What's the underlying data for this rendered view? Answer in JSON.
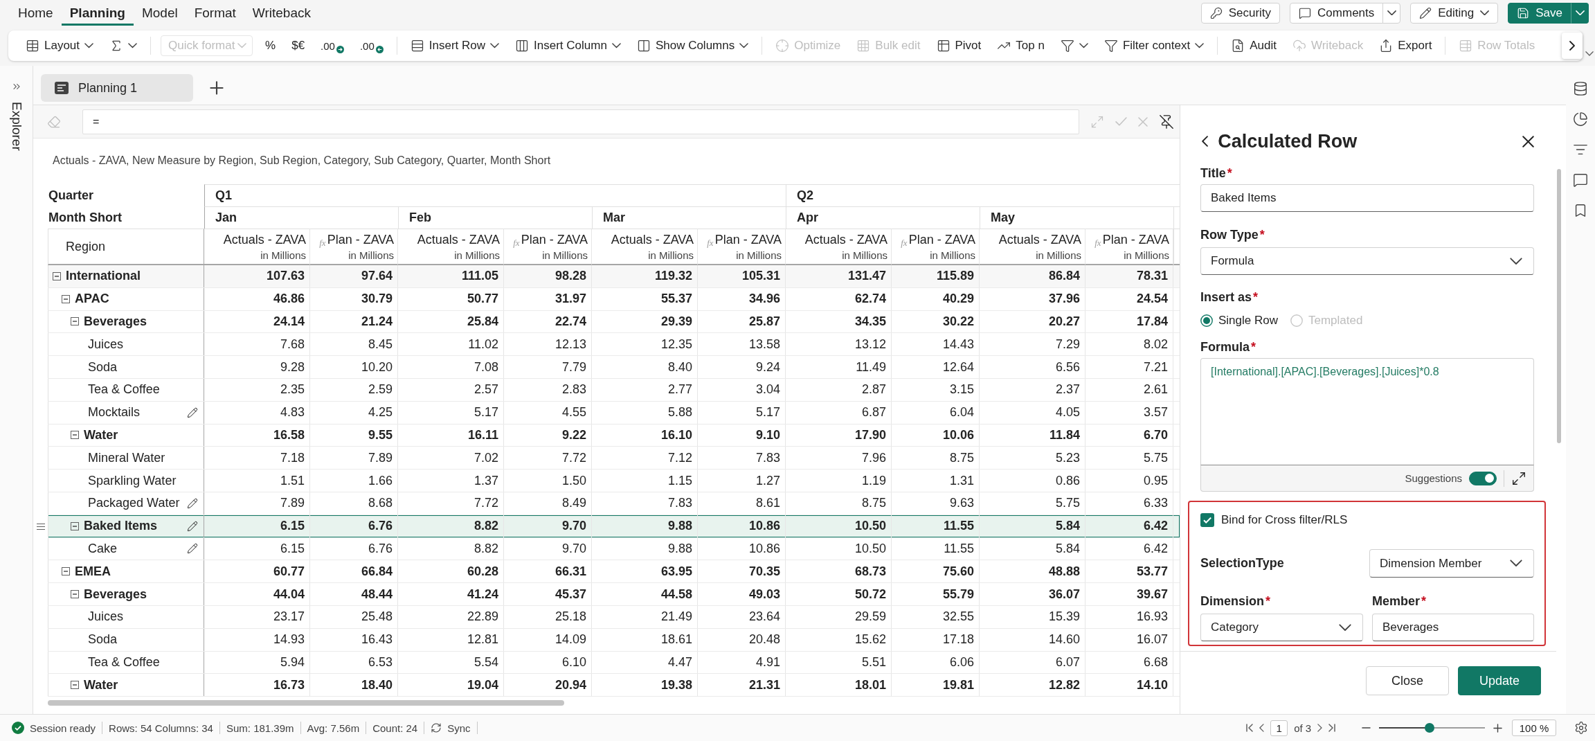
{
  "menu_tabs": [
    {
      "label": "Home",
      "selected": false
    },
    {
      "label": "Planning",
      "selected": true
    },
    {
      "label": "Model",
      "selected": false
    },
    {
      "label": "Format",
      "selected": false
    },
    {
      "label": "Writeback",
      "selected": false
    }
  ],
  "header_actions": [
    {
      "label": "Security",
      "kind": "button"
    },
    {
      "label": "Comments",
      "kind": "split"
    },
    {
      "label": "Editing",
      "kind": "menu"
    },
    {
      "label": "Save",
      "kind": "primary"
    }
  ],
  "toolbar": {
    "groups": [
      [
        {
          "kind": "button",
          "label": "Layout",
          "dropdown": true,
          "disabled": false
        },
        {
          "kind": "icon",
          "dropdown": true,
          "disabled": false
        }
      ],
      [
        {
          "kind": "select",
          "placeholder": "Quick format",
          "dropdown": true,
          "disabled": true
        },
        {
          "kind": "glyph",
          "label": "%",
          "dropdown": false,
          "disabled": false
        },
        {
          "kind": "glyph",
          "label": "$€",
          "dropdown": false,
          "disabled": false
        },
        {
          "kind": "increase",
          "label": ".00",
          "dropdown": false,
          "disabled": false
        },
        {
          "kind": "decrease",
          "label": ".00",
          "dropdown": false,
          "disabled": false
        }
      ],
      [
        {
          "kind": "button",
          "label": "Insert Row",
          "dropdown": true,
          "disabled": false
        },
        {
          "kind": "button",
          "label": "Insert Column",
          "dropdown": true,
          "disabled": false
        },
        {
          "kind": "button",
          "label": "Show Columns",
          "dropdown": true,
          "disabled": false
        }
      ],
      [
        {
          "kind": "button",
          "label": "Optimize",
          "dropdown": false,
          "disabled": true
        },
        {
          "kind": "button",
          "label": "Bulk edit",
          "dropdown": false,
          "disabled": true
        },
        {
          "kind": "button",
          "label": "Pivot",
          "dropdown": false,
          "disabled": false
        },
        {
          "kind": "button",
          "label": "Top n",
          "dropdown": false,
          "disabled": false
        },
        {
          "kind": "icon",
          "dropdown": true,
          "disabled": false
        },
        {
          "kind": "button",
          "label": "Filter context",
          "dropdown": true,
          "disabled": false
        }
      ],
      [
        {
          "kind": "button",
          "label": "Audit",
          "dropdown": false,
          "disabled": false
        },
        {
          "kind": "button",
          "label": "Writeback",
          "dropdown": false,
          "disabled": true
        },
        {
          "kind": "button",
          "label": "Export",
          "dropdown": false,
          "disabled": false
        }
      ],
      [
        {
          "kind": "button",
          "label": "Row Totals",
          "dropdown": false,
          "disabled": true
        }
      ]
    ]
  },
  "explorer": {
    "label": "Explorer"
  },
  "sheet_tabs": [
    {
      "label": "Planning 1",
      "selected": true
    }
  ],
  "formula_bar": {
    "value": "="
  },
  "grid": {
    "title": "Actuals - ZAVA, New Measure by Region, Sub Region, Category, Sub Category, Quarter, Month Short",
    "header_labels": {
      "quarter": "Quarter",
      "month": "Month Short",
      "region": "Region"
    },
    "quarters": [
      {
        "label": "Q1",
        "months": [
          {
            "label": "Jan",
            "measures": [
              {
                "label": "Actuals - ZAVA",
                "unit": "in Millions"
              },
              {
                "label": "Plan - ZAVA",
                "unit": "in Millions",
                "formula_mark": "fx"
              }
            ]
          },
          {
            "label": "Feb",
            "measures": [
              {
                "label": "Actuals - ZAVA",
                "unit": "in Millions"
              },
              {
                "label": "Plan - ZAVA",
                "unit": "in Millions",
                "formula_mark": "fx"
              }
            ]
          },
          {
            "label": "Mar",
            "measures": [
              {
                "label": "Actuals - ZAVA",
                "unit": "in Millions"
              },
              {
                "label": "Plan - ZAVA",
                "unit": "in Millions",
                "formula_mark": "fx"
              }
            ]
          }
        ]
      },
      {
        "label": "Q2",
        "months": [
          {
            "label": "Apr",
            "measures": [
              {
                "label": "Actuals - ZAVA",
                "unit": "in Millions"
              },
              {
                "label": "Plan - ZAVA",
                "unit": "in Millions",
                "formula_mark": "fx"
              }
            ]
          },
          {
            "label": "May",
            "measures": [
              {
                "label": "Actuals - ZAVA",
                "unit": "in Millions"
              },
              {
                "label": "Plan - ZAVA",
                "unit": "in Millions",
                "formula_mark": "fx"
              }
            ]
          }
        ]
      }
    ],
    "rows": [
      {
        "label": "International",
        "kind": "group",
        "expanded": true,
        "selected": false,
        "edited": false,
        "values": [
          "107.63",
          "97.64",
          "111.05",
          "98.28",
          "119.32",
          "105.31",
          "131.47",
          "115.89",
          "86.84",
          "78.31"
        ],
        "children": [
          {
            "label": "APAC",
            "kind": "group",
            "expanded": true,
            "selected": false,
            "edited": false,
            "values": [
              "46.86",
              "30.79",
              "50.77",
              "31.97",
              "55.37",
              "34.96",
              "62.74",
              "40.29",
              "37.96",
              "24.54"
            ],
            "children": [
              {
                "label": "Beverages",
                "kind": "group",
                "expanded": true,
                "selected": false,
                "edited": false,
                "values": [
                  "24.14",
                  "21.24",
                  "25.84",
                  "22.74",
                  "29.39",
                  "25.87",
                  "34.35",
                  "30.22",
                  "20.27",
                  "17.84"
                ],
                "children": [
                  {
                    "label": "Juices",
                    "kind": "leaf",
                    "selected": false,
                    "edited": false,
                    "values": [
                      "7.68",
                      "8.45",
                      "11.02",
                      "12.13",
                      "12.35",
                      "13.58",
                      "13.12",
                      "14.43",
                      "7.29",
                      "8.02"
                    ]
                  },
                  {
                    "label": "Soda",
                    "kind": "leaf",
                    "selected": false,
                    "edited": false,
                    "values": [
                      "9.28",
                      "10.20",
                      "7.08",
                      "7.79",
                      "8.40",
                      "9.24",
                      "11.49",
                      "12.64",
                      "6.56",
                      "7.21"
                    ]
                  },
                  {
                    "label": "Tea & Coffee",
                    "kind": "leaf",
                    "selected": false,
                    "edited": false,
                    "values": [
                      "2.35",
                      "2.59",
                      "2.57",
                      "2.83",
                      "2.77",
                      "3.04",
                      "2.87",
                      "3.15",
                      "2.37",
                      "2.61"
                    ]
                  },
                  {
                    "label": "Mocktails",
                    "kind": "leaf",
                    "selected": false,
                    "edited": true,
                    "values": [
                      "4.83",
                      "4.25",
                      "5.17",
                      "4.55",
                      "5.88",
                      "5.17",
                      "6.87",
                      "6.04",
                      "4.05",
                      "3.57"
                    ]
                  }
                ]
              },
              {
                "label": "Water",
                "kind": "group",
                "expanded": true,
                "selected": false,
                "edited": false,
                "values": [
                  "16.58",
                  "9.55",
                  "16.11",
                  "9.22",
                  "16.10",
                  "9.10",
                  "17.90",
                  "10.06",
                  "11.84",
                  "6.70"
                ],
                "children": [
                  {
                    "label": "Mineral Water",
                    "kind": "leaf",
                    "selected": false,
                    "edited": false,
                    "values": [
                      "7.18",
                      "7.89",
                      "7.02",
                      "7.72",
                      "7.12",
                      "7.83",
                      "7.96",
                      "8.75",
                      "5.23",
                      "5.75"
                    ]
                  },
                  {
                    "label": "Sparkling Water",
                    "kind": "leaf",
                    "selected": false,
                    "edited": false,
                    "values": [
                      "1.51",
                      "1.66",
                      "1.37",
                      "1.50",
                      "1.15",
                      "1.27",
                      "1.19",
                      "1.31",
                      "0.86",
                      "0.95"
                    ]
                  },
                  {
                    "label": "Packaged Water",
                    "kind": "leaf",
                    "selected": false,
                    "edited": true,
                    "values": [
                      "7.89",
                      "8.68",
                      "7.72",
                      "8.49",
                      "7.83",
                      "8.61",
                      "8.75",
                      "9.63",
                      "5.75",
                      "6.33"
                    ]
                  }
                ]
              },
              {
                "label": "Baked Items",
                "kind": "group",
                "expanded": true,
                "selected": true,
                "edited": true,
                "values": [
                  "6.15",
                  "6.76",
                  "8.82",
                  "9.70",
                  "9.88",
                  "10.86",
                  "10.50",
                  "11.55",
                  "5.84",
                  "6.42"
                ],
                "children": [
                  {
                    "label": "Cake",
                    "kind": "leaf",
                    "selected": false,
                    "edited": true,
                    "values": [
                      "6.15",
                      "6.76",
                      "8.82",
                      "9.70",
                      "9.88",
                      "10.86",
                      "10.50",
                      "11.55",
                      "5.84",
                      "6.42"
                    ]
                  }
                ]
              }
            ]
          },
          {
            "label": "EMEA",
            "kind": "group",
            "expanded": true,
            "selected": false,
            "edited": false,
            "values": [
              "60.77",
              "66.84",
              "60.28",
              "66.31",
              "63.95",
              "70.35",
              "68.73",
              "75.60",
              "48.88",
              "53.77"
            ],
            "children": [
              {
                "label": "Beverages",
                "kind": "group",
                "expanded": true,
                "selected": false,
                "edited": false,
                "values": [
                  "44.04",
                  "48.44",
                  "41.24",
                  "45.37",
                  "44.58",
                  "49.03",
                  "50.72",
                  "55.79",
                  "36.07",
                  "39.67"
                ],
                "children": [
                  {
                    "label": "Juices",
                    "kind": "leaf",
                    "selected": false,
                    "edited": false,
                    "values": [
                      "23.17",
                      "25.48",
                      "22.89",
                      "25.18",
                      "21.49",
                      "23.64",
                      "29.59",
                      "32.55",
                      "15.39",
                      "16.93"
                    ]
                  },
                  {
                    "label": "Soda",
                    "kind": "leaf",
                    "selected": false,
                    "edited": false,
                    "values": [
                      "14.93",
                      "16.43",
                      "12.81",
                      "14.09",
                      "18.61",
                      "20.48",
                      "15.62",
                      "17.18",
                      "14.60",
                      "16.07"
                    ]
                  },
                  {
                    "label": "Tea & Coffee",
                    "kind": "leaf",
                    "selected": false,
                    "edited": false,
                    "values": [
                      "5.94",
                      "6.53",
                      "5.54",
                      "6.10",
                      "4.47",
                      "4.91",
                      "5.51",
                      "6.06",
                      "6.07",
                      "6.68"
                    ]
                  }
                ]
              },
              {
                "label": "Water",
                "kind": "group",
                "expanded": true,
                "selected": false,
                "edited": false,
                "values": [
                  "16.73",
                  "18.40",
                  "19.04",
                  "20.94",
                  "19.38",
                  "21.31",
                  "18.01",
                  "19.81",
                  "12.82",
                  "14.10"
                ]
              }
            ]
          }
        ]
      }
    ]
  },
  "calc_panel": {
    "title": "Calculated Row",
    "title_field": {
      "label": "Title",
      "required": "*",
      "value": "Baked Items"
    },
    "row_type": {
      "label": "Row Type",
      "required": "*",
      "value": "Formula"
    },
    "insert_as": {
      "label": "Insert as",
      "required": "*",
      "options": [
        {
          "label": "Single Row",
          "selected": true,
          "disabled": false
        },
        {
          "label": "Templated",
          "selected": false,
          "disabled": true
        }
      ]
    },
    "formula": {
      "label": "Formula",
      "required": "*",
      "value": "[International].[APAC].[Beverages].[Juices]*0.8",
      "suggestions": {
        "label": "Suggestions",
        "on": true
      }
    },
    "cross_filter": {
      "highlighted": true,
      "bind": {
        "label": "Bind for Cross filter/RLS",
        "checked": true
      },
      "selection_type": {
        "label": "SelectionType",
        "value": "Dimension Member"
      },
      "dimension": {
        "label": "Dimension",
        "required": "*",
        "value": "Category"
      },
      "member": {
        "label": "Member",
        "required": "*",
        "value": "Beverages"
      }
    },
    "buttons": [
      {
        "label": "Close"
      },
      {
        "label": "Update"
      }
    ]
  },
  "status_bar": {
    "status": "Session ready",
    "stats": [
      "Rows: 54 Columns: 34",
      "Sum: 181.39m",
      "Avg: 7.56m",
      "Count: 24"
    ],
    "sync": "Sync",
    "pagination": {
      "page": "1",
      "total": "of 3"
    },
    "zoom": {
      "level": 0.48,
      "reading": "100 %"
    }
  }
}
